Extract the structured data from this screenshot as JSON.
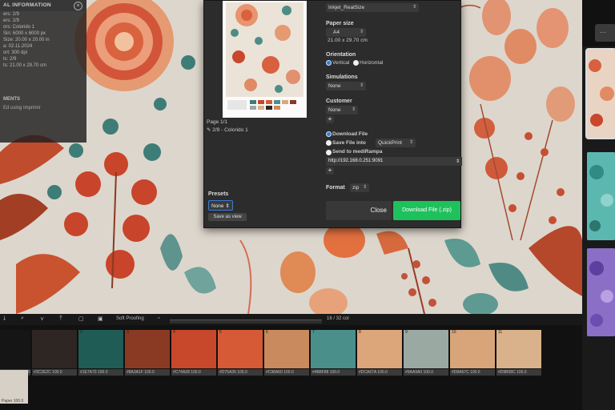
{
  "info_panel": {
    "title": "AL INFORMATION",
    "lines": [
      "ers: 2/9",
      "ers: 2/9",
      "ors: Colorido 1",
      "Sin: 6000 x 6000 px",
      "Size: 20.00 x 20.00 in",
      "a: 02.11.2024",
      "ort: 300 dpi",
      "ts: 2/9",
      "ts: 21.00 x 29.70 cm"
    ],
    "section": "MENTS",
    "row": "Ed using Imprimir"
  },
  "dialog": {
    "page": "Page 1/1",
    "page_sub": "2/9 - Colorido 1",
    "presets_label": "Presets",
    "presets_value": "None",
    "save_view": "Save as view",
    "size_preset": "Inkjet_RealSize",
    "paper_size_label": "Paper size",
    "paper_size_value": "A4",
    "paper_dims": "21.00 x 29.70 cm",
    "orientation_label": "Orientation",
    "orientation_vertical": "Vertical",
    "orientation_horizontal": "Horizontal",
    "simulations_label": "Simulations",
    "simulations_value": "None",
    "customer_label": "Customer",
    "customer_value": "None",
    "opt_download": "Download File",
    "opt_save_into": "Save File into",
    "save_into_value": "QuickPrint",
    "opt_send": "Send to mediRampa",
    "url_value": "http://192.168.0.251:9091",
    "format_label": "Format",
    "format_value": "zip",
    "close_label": "Close",
    "download_label": "Download File (.zip)"
  },
  "toolbar": {
    "proofing": "Soft Proofing",
    "count": "16 / 32 col"
  },
  "palette": {
    "swatches": [
      {
        "idx": "",
        "color": "#151515",
        "label": "#1C1C1C  100.0"
      },
      {
        "idx": "1",
        "color": "#2d2623",
        "label": "#3C2E2C  100.0"
      },
      {
        "idx": "2",
        "color": "#1e5c55",
        "label": "#1E7A70  100.0"
      },
      {
        "idx": "3",
        "color": "#8a3a23",
        "label": "#8A3A1F  100.0"
      },
      {
        "idx": "4",
        "color": "#c7482a",
        "label": "#C74A28  100.0"
      },
      {
        "idx": "5",
        "color": "#d75a37",
        "label": "#D75A36  100.0"
      },
      {
        "idx": "6",
        "color": "#c98a5d",
        "label": "#C98A60  100.0"
      },
      {
        "idx": "7",
        "color": "#4b8f8a",
        "label": "#4B8F88  100.0"
      },
      {
        "idx": "8",
        "color": "#dca57a",
        "label": "#DCA67A  100.0"
      },
      {
        "idx": "9",
        "color": "#9aa9a2",
        "label": "#9AA9A0  100.0"
      },
      {
        "idx": "10",
        "color": "#d8a57a",
        "label": "#D8A67C  100.0"
      },
      {
        "idx": "11",
        "color": "#d9b18a",
        "label": "#D9B08C  100.0"
      }
    ],
    "paper_label": "Paper  100.0"
  },
  "icons": {
    "info_close": "circle-close-icon",
    "page_icon": "pencil-icon",
    "plus": "plus-icon",
    "toolbar": [
      "eyedropper-icon",
      "search-icon",
      "pin-icon",
      "crop-icon",
      "image-icon"
    ]
  },
  "colors": {
    "accent": "#2f7ee0",
    "download": "#1ec15c",
    "dialog_bg": "#2c2c2c"
  }
}
